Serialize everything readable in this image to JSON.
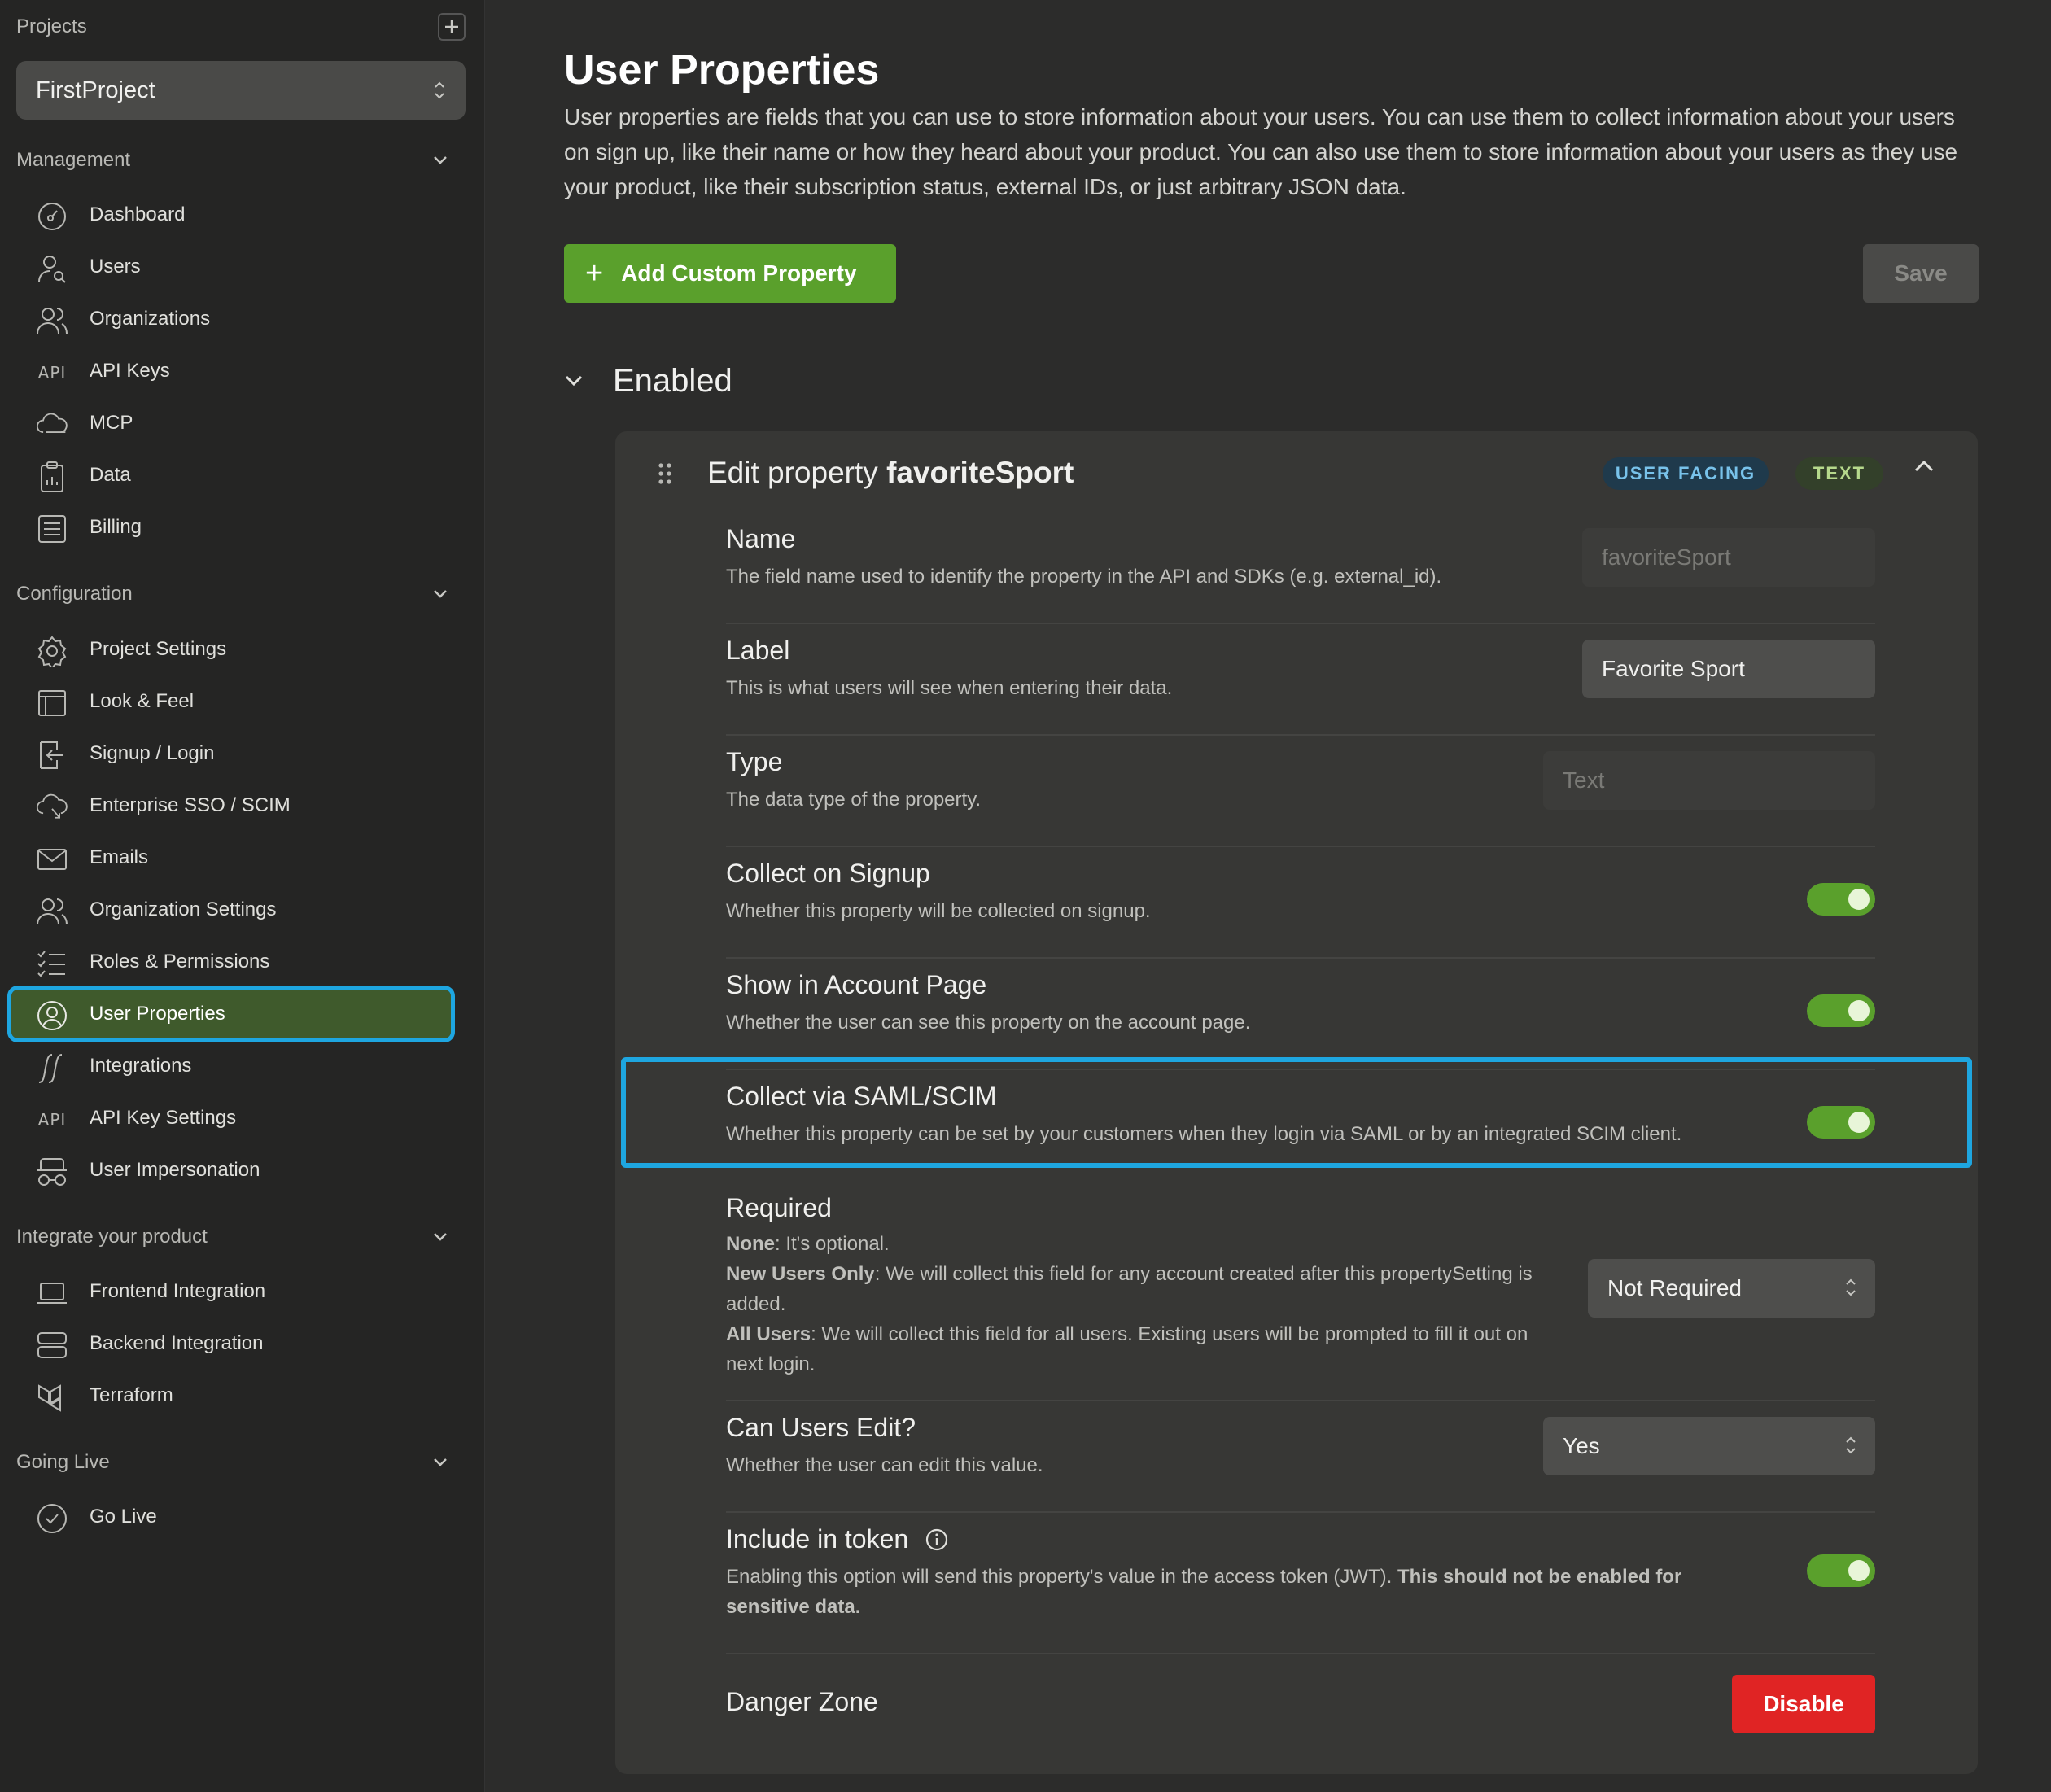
{
  "sidebar": {
    "projects_label": "Projects",
    "project_selected": "FirstProject",
    "sections": {
      "management": "Management",
      "configuration": "Configuration",
      "integrate": "Integrate your product",
      "going_live": "Going Live"
    },
    "management_items": [
      {
        "label": "Dashboard",
        "icon": "dashboard-icon"
      },
      {
        "label": "Users",
        "icon": "users-search-icon"
      },
      {
        "label": "Organizations",
        "icon": "organizations-icon"
      },
      {
        "label": "API Keys",
        "icon": "api-icon",
        "icon_text": "API"
      },
      {
        "label": "MCP",
        "icon": "cloud-icon"
      },
      {
        "label": "Data",
        "icon": "clipboard-chart-icon"
      },
      {
        "label": "Billing",
        "icon": "billing-list-icon"
      }
    ],
    "configuration_items": [
      {
        "label": "Project Settings",
        "icon": "gear-icon"
      },
      {
        "label": "Look & Feel",
        "icon": "window-icon"
      },
      {
        "label": "Signup / Login",
        "icon": "login-icon"
      },
      {
        "label": "Enterprise SSO / SCIM",
        "icon": "cloud-arrow-icon"
      },
      {
        "label": "Emails",
        "icon": "mail-icon"
      },
      {
        "label": "Organization Settings",
        "icon": "organization-settings-icon"
      },
      {
        "label": "Roles & Permissions",
        "icon": "checklist-icon"
      },
      {
        "label": "User Properties",
        "icon": "user-circle-icon",
        "active": true
      },
      {
        "label": "Integrations",
        "icon": "integrations-icon"
      },
      {
        "label": "API Key Settings",
        "icon": "api-icon",
        "icon_text": "API"
      },
      {
        "label": "User Impersonation",
        "icon": "impersonation-icon"
      }
    ],
    "integrate_items": [
      {
        "label": "Frontend Integration",
        "icon": "laptop-icon"
      },
      {
        "label": "Backend Integration",
        "icon": "server-icon"
      },
      {
        "label": "Terraform",
        "icon": "terraform-icon"
      }
    ],
    "going_live_items": [
      {
        "label": "Go Live",
        "icon": "check-circle-icon"
      }
    ]
  },
  "main": {
    "title": "User Properties",
    "description": "User properties are fields that you can use to store information about your users. You can use them to collect information about your users on sign up, like their name or how they heard about your product. You can also use them to store information about your users as they use your product, like their subscription status, external IDs, or just arbitrary JSON data.",
    "add_button": "Add Custom Property",
    "save_button": "Save",
    "enabled_section": "Enabled",
    "card": {
      "title_prefix": "Edit property",
      "property_name": "favoriteSport",
      "badge_user_facing": "USER FACING",
      "badge_text": "TEXT",
      "rows": {
        "name": {
          "title": "Name",
          "desc": "The field name used to identify the property in the API and SDKs (e.g. external_id).",
          "value": "favoriteSport"
        },
        "label": {
          "title": "Label",
          "desc": "This is what users will see when entering their data.",
          "value": "Favorite Sport"
        },
        "type": {
          "title": "Type",
          "desc": "The data type of the property.",
          "value": "Text"
        },
        "collect_signup": {
          "title": "Collect on Signup",
          "desc": "Whether this property will be collected on signup.",
          "on": true
        },
        "show_account": {
          "title": "Show in Account Page",
          "desc": "Whether the user can see this property on the account page.",
          "on": true
        },
        "collect_saml": {
          "title": "Collect via SAML/SCIM",
          "desc": "Whether this property can be set by your customers when they login via SAML or by an integrated SCIM client.",
          "on": true
        },
        "required": {
          "title": "Required",
          "none_term": "None",
          "none_desc": ": It's optional.",
          "new_term": "New Users Only",
          "new_desc": ": We will collect this field for any account created after this propertySetting is added.",
          "all_term": "All Users",
          "all_desc": ": We will collect this field for all users. Existing users will be prompted to fill it out on next login.",
          "value": "Not Required"
        },
        "can_edit": {
          "title": "Can Users Edit?",
          "desc": "Whether the user can edit this value.",
          "value": "Yes"
        },
        "include_token": {
          "title": "Include in token",
          "desc": "Enabling this option will send this property's value in the access token (JWT). ",
          "desc_bold": "This should not be enabled for sensitive data.",
          "on": true
        },
        "danger": {
          "title": "Danger Zone",
          "button": "Disable"
        }
      }
    }
  },
  "colors": {
    "accent_green": "#5aa02c",
    "highlight_blue": "#1ea6e0",
    "danger_red": "#e02424"
  }
}
